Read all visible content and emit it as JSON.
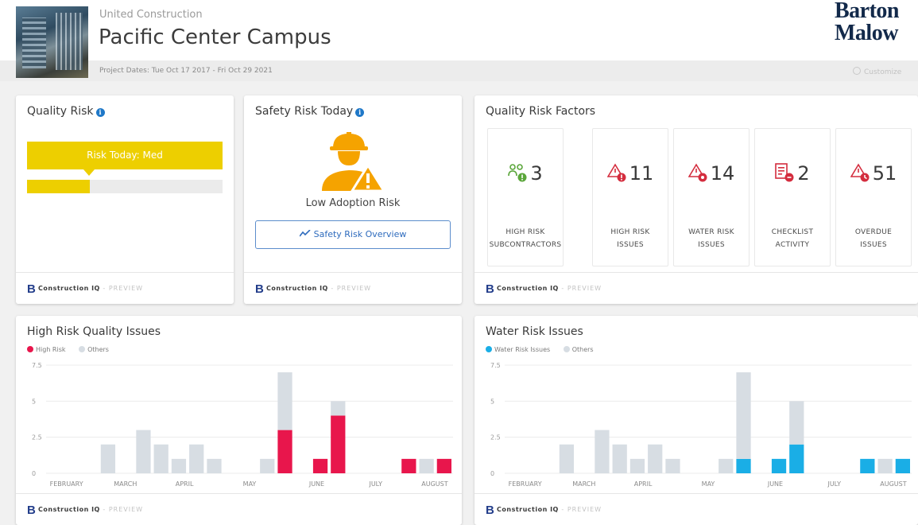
{
  "header": {
    "company": "United Construction",
    "title": "Pacific Center Campus",
    "dates": "Project Dates: Tue Oct 17 2017 - Fri Oct 29 2021",
    "logo_line1": "Barton",
    "logo_line2": "Malow",
    "customize": "Customize"
  },
  "footer": {
    "b": "B",
    "brand": "Construction IQ",
    "preview": " - PREVIEW"
  },
  "quality_risk": {
    "title": "Quality Risk",
    "bar_label": "Risk Today: Med",
    "level_fraction": 0.32,
    "color": "#edcf00"
  },
  "safety_risk": {
    "title": "Safety Risk Today",
    "label": "Low Adoption Risk",
    "button": "Safety Risk Overview"
  },
  "factors": {
    "title": "Quality Risk Factors",
    "items": [
      {
        "value": "3",
        "line1": "HIGH RISK",
        "line2": "SUBCONTRACTORS",
        "icon": "subcontractors-icon"
      },
      {
        "value": "11",
        "line1": "HIGH RISK",
        "line2": "ISSUES",
        "icon": "high-risk-issue-icon"
      },
      {
        "value": "14",
        "line1": "WATER RISK",
        "line2": "ISSUES",
        "icon": "water-risk-icon"
      },
      {
        "value": "2",
        "line1": "CHECKLIST",
        "line2": "ACTIVITY",
        "icon": "checklist-icon"
      },
      {
        "value": "51",
        "line1": "OVERDUE",
        "line2": "ISSUES",
        "icon": "overdue-icon"
      }
    ]
  },
  "chart_data": [
    {
      "type": "bar",
      "title": "High Risk Quality Issues",
      "legend": [
        "High Risk",
        "Others"
      ],
      "colors": {
        "highlight": "#e8164c",
        "other": "#d7dde3"
      },
      "ylim": [
        0,
        7.5
      ],
      "yticks": [
        "7.5",
        "5",
        "2.5",
        "0"
      ],
      "xticks": [
        "FEBRUARY",
        "MARCH",
        "APRIL",
        "MAY",
        "JUNE",
        "JULY",
        "AUGUST"
      ],
      "series": [
        {
          "name": "High Risk",
          "values": [
            0,
            0,
            0,
            0,
            0,
            0,
            0,
            0,
            0,
            0,
            0,
            0,
            0,
            3,
            0,
            1,
            4,
            0,
            0,
            0,
            1,
            0,
            1
          ]
        },
        {
          "name": "Others",
          "values": [
            0,
            0,
            0,
            2,
            0,
            3,
            2,
            1,
            2,
            1,
            0,
            0,
            1,
            4,
            0,
            0,
            1,
            0,
            0,
            0,
            0,
            1,
            0
          ]
        }
      ],
      "highlight_positions": [
        0,
        0,
        0,
        0,
        0,
        0,
        0,
        0,
        0,
        0,
        0,
        1,
        1,
        1,
        0,
        1,
        1,
        0,
        0,
        0,
        1,
        1,
        1
      ]
    },
    {
      "type": "bar",
      "title": "Water Risk Issues",
      "legend": [
        "Water Risk Issues",
        "Others"
      ],
      "colors": {
        "highlight": "#1aaee6",
        "other": "#d7dde3"
      },
      "ylim": [
        0,
        7.5
      ],
      "yticks": [
        "7.5",
        "5",
        "2.5",
        "0"
      ],
      "xticks": [
        "FEBRUARY",
        "MARCH",
        "APRIL",
        "MAY",
        "JUNE",
        "JULY",
        "AUGUST"
      ],
      "series": [
        {
          "name": "Water Risk Issues",
          "values": [
            0,
            0,
            0,
            0,
            0,
            0,
            0,
            0,
            0,
            0,
            0,
            0,
            0,
            1,
            0,
            1,
            2,
            0,
            0,
            0,
            1,
            0,
            1
          ]
        },
        {
          "name": "Others",
          "values": [
            0,
            0,
            0,
            2,
            0,
            3,
            2,
            1,
            2,
            1,
            0,
            0,
            1,
            6,
            0,
            0,
            3,
            0,
            0,
            0,
            0,
            1,
            0
          ]
        }
      ]
    }
  ]
}
